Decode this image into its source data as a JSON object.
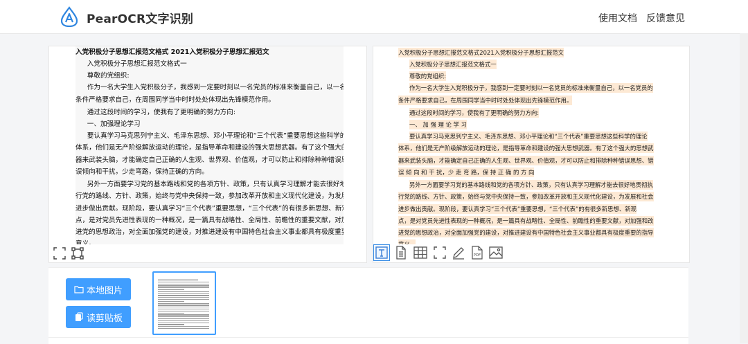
{
  "header": {
    "brand": "PearOCR文字识别",
    "nav": [
      "使用文档",
      "反馈意见"
    ]
  },
  "left_doc": {
    "lines": [
      "入党积极分子思想汇报范文格式 2021入党积极分子思想汇报范文",
      "入党积极分子思想汇报范文格式一",
      "尊敬的党组织:",
      "作为一名大学生入党积极分子，我感到一定要时刻以一名党员的标准来衡量自己，以一名党员的",
      "条件严格要求自己，在周围同学当中时时处处体现出先锋模范作用。",
      "通过这段时间的学习，使我有了更明确的努力方向:",
      "一、加强理论学习",
      "要认真学习马克思列宁主义、毛泽东思想、邓小平理论和“三个代表”重要思想这些科学的理论",
      "体系，他们是无产阶级解放运动的理论，是指导革命和建设的强大思想武器。有了这个强大的思想武",
      "器来武装头脑，才能确定自己正确的人生观、世界观、价值观，才可以防止和排除种种错误思想、错",
      "误倾向和干扰，少走弯路，保持正确的方向。",
      "另外一方面要学习党的基本路线和党的各项方针、政策，只有认真学习理解才能去很好地贯彻执",
      "行党的路线、方针、政策，始终与党中央保持一致，参加改革开放和主义现代化建设，为发展和社会",
      "进步做出贡献。现阶段，要认真学习“三个代表”重要思想，“三个代表”的有很多新思想、新观",
      "点，是对党员先进性表现的一种概况，是一篇具有战略性、全局性、前瞻性的重要文献，对加强和改",
      "进党的思想政治，对全面加强党的建设，对推进建设有中国特色社会主义事业都具有极度重要的指导",
      "意义。"
    ]
  },
  "right_doc": {
    "lines": [
      "入党积极分子思想汇报范文格式2021入党积极分子思想汇报范文",
      "入党积极分子思想汇报范文格式一",
      "尊敬的党组织:",
      "作为一名大学生入党积极分子，我感到一定要时刻以一名党员的标准来衡量自己，以一名党员的",
      "条件严格要求自己，在周围同学当中时时处处体现出先锋模范作用。",
      "通过这段时间的学习，使我有了更明确的努力方向:",
      "一、 加 强 理 论 学 习",
      "要认真学习马克思列宁主义、毛泽东思想、邓小平理论和“三个代表”重要思想这些科学的理论",
      "体系，他们是无产阶级解放运动的理论，是指导革命和建设的强大思想武器。有了这个强大的思想武",
      "器来武装头脑，才能确定自己正确的人生观、世界观、价值观，才可以防止和排除种种错误思想、错",
      "误 倾 向 和 干 扰，少 走 弯 路，保 持 正 确 的 方 向",
      "另外一方面要学习党的基本路线和党的各项方针、政策，只有认真学习理解才能去很好地贯彻执",
      "行党的路线、方针、政策，始终与党中央保持一致，参加改革开放和主义现代化建设，为发展和社会",
      "进步做出贡献。现阶段，要认真学习“三个代表”重要思想，“三个代表”的有很多新思想、新观",
      "点，是对党员先进性表现的一种概况，是一篇具有战略性、全局性、前瞻性的重要文献，对加强和改",
      "进党的思想政治，对全面加强党的建设，对推进建设有中国特色社会主义事业都具有极度重要的指导",
      "意义。"
    ]
  },
  "buttons": {
    "local_image": "本地图片",
    "read_clipboard": "读剪贴板"
  },
  "colors": {
    "accent": "#409eff",
    "highlight": "#fde9d4"
  },
  "toolbar_icons": [
    "text-mode-icon",
    "document-icon",
    "table-icon",
    "fullscreen-icon",
    "edit-icon",
    "pdf-icon",
    "image-icon"
  ]
}
